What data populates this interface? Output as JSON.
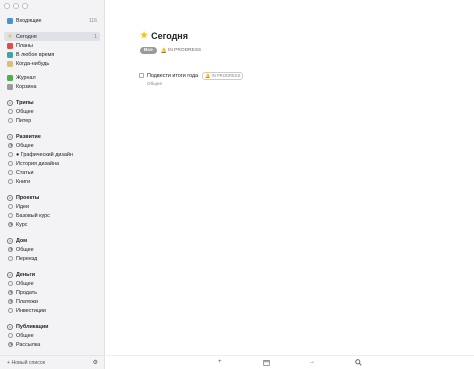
{
  "colors": {
    "inbox": "#4a90d9",
    "today": "#f3c21b",
    "plans": "#e04b4b",
    "anytime": "#39a8a0",
    "someday": "#d9c07a",
    "logbook": "#4caf50",
    "trash": "#9a9a9e"
  },
  "sidebar": {
    "inbox": {
      "label": "Входящие",
      "count": "116"
    },
    "smart": [
      {
        "label": "Сегодня",
        "count": "1",
        "icon": "star-icon",
        "selected": true
      },
      {
        "label": "Планы",
        "count": "",
        "icon": "calendar-icon"
      },
      {
        "label": "В любое время",
        "count": "",
        "icon": "layers-icon"
      },
      {
        "label": "Когда-нибудь",
        "count": "",
        "icon": "archive-box-icon"
      }
    ],
    "logs": [
      {
        "label": "Журнал",
        "icon": "logbook-icon"
      },
      {
        "label": "Корзина",
        "icon": "trash-icon"
      }
    ],
    "areas": [
      {
        "title": "Трипы",
        "items": [
          "Общее",
          "Питер"
        ]
      },
      {
        "title": "Развитие",
        "items": [
          "Общее",
          "● Графический дизайн",
          "История дизайна",
          "Статьи",
          "Книги"
        ]
      },
      {
        "title": "Проекты",
        "items": [
          "Идеи",
          "Базовый курс",
          "Курс"
        ]
      },
      {
        "title": "Дом",
        "items": [
          "Общее",
          "Переезд"
        ]
      },
      {
        "title": "Деньги",
        "items": [
          "Общее",
          "Продать",
          "Платежи",
          "Инвестиции"
        ]
      },
      {
        "title": "Публикации",
        "items": [
          "Общее",
          "Рассылка"
        ]
      }
    ],
    "new_list": "+ Новый список",
    "filter_icon": "settings-sliders-icon"
  },
  "main": {
    "title": "Сегодня",
    "chip_all": "Все",
    "chip_tag": "IN PRODRESS",
    "task": {
      "title": "Подвести итоги года",
      "tag": "IN PRODRESS",
      "project": "Общее"
    },
    "toolbar": {
      "add": "+",
      "calendar_icon": "calendar-icon",
      "move": "→",
      "search_icon": "search-icon"
    }
  }
}
